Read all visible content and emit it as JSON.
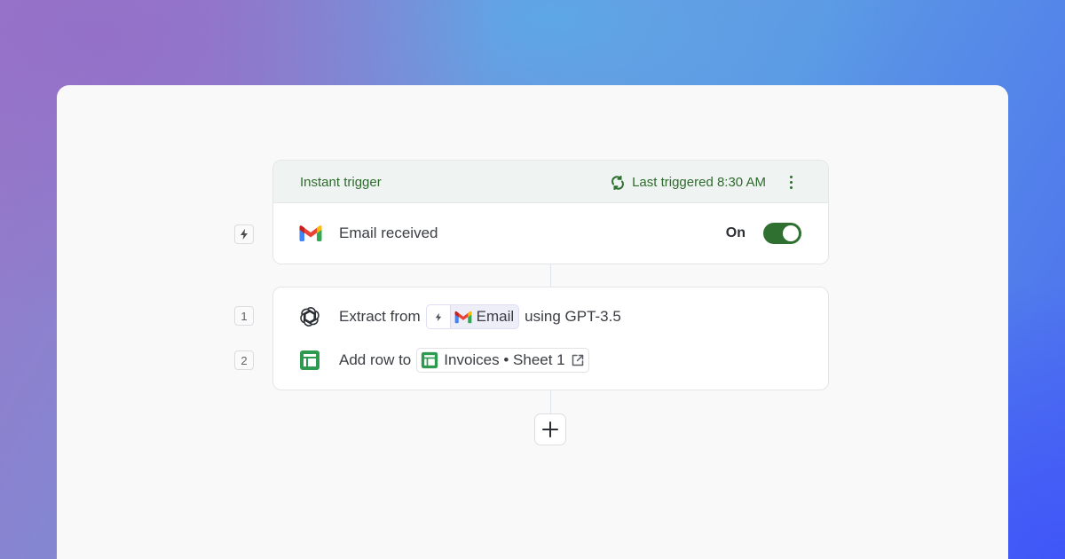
{
  "trigger": {
    "header_title": "Instant trigger",
    "last_triggered": "Last triggered 8:30 AM",
    "event_label": "Email received",
    "toggle_label": "On",
    "toggle_on": true,
    "icons": [
      "refresh-icon",
      "kebab-menu-icon",
      "bolt-icon",
      "gmail-icon"
    ]
  },
  "steps": [
    {
      "number": "1",
      "prefix": "Extract from",
      "chip_label": "Email",
      "suffix": "using GPT-3.5",
      "icons": [
        "openai-icon",
        "bolt-icon",
        "gmail-icon"
      ]
    },
    {
      "number": "2",
      "prefix": "Add row to",
      "chip_label": "Invoices • Sheet 1",
      "icons": [
        "google-sheets-icon",
        "external-link-icon"
      ]
    }
  ],
  "add_step": {
    "icon": "plus-icon"
  },
  "colors": {
    "accent_green": "#2f7030",
    "header_text": "#2f6b2f",
    "header_bg": "#eff3f1",
    "panel_bg": "#f9f9f9",
    "chip_highlight": "#eeeef9"
  }
}
